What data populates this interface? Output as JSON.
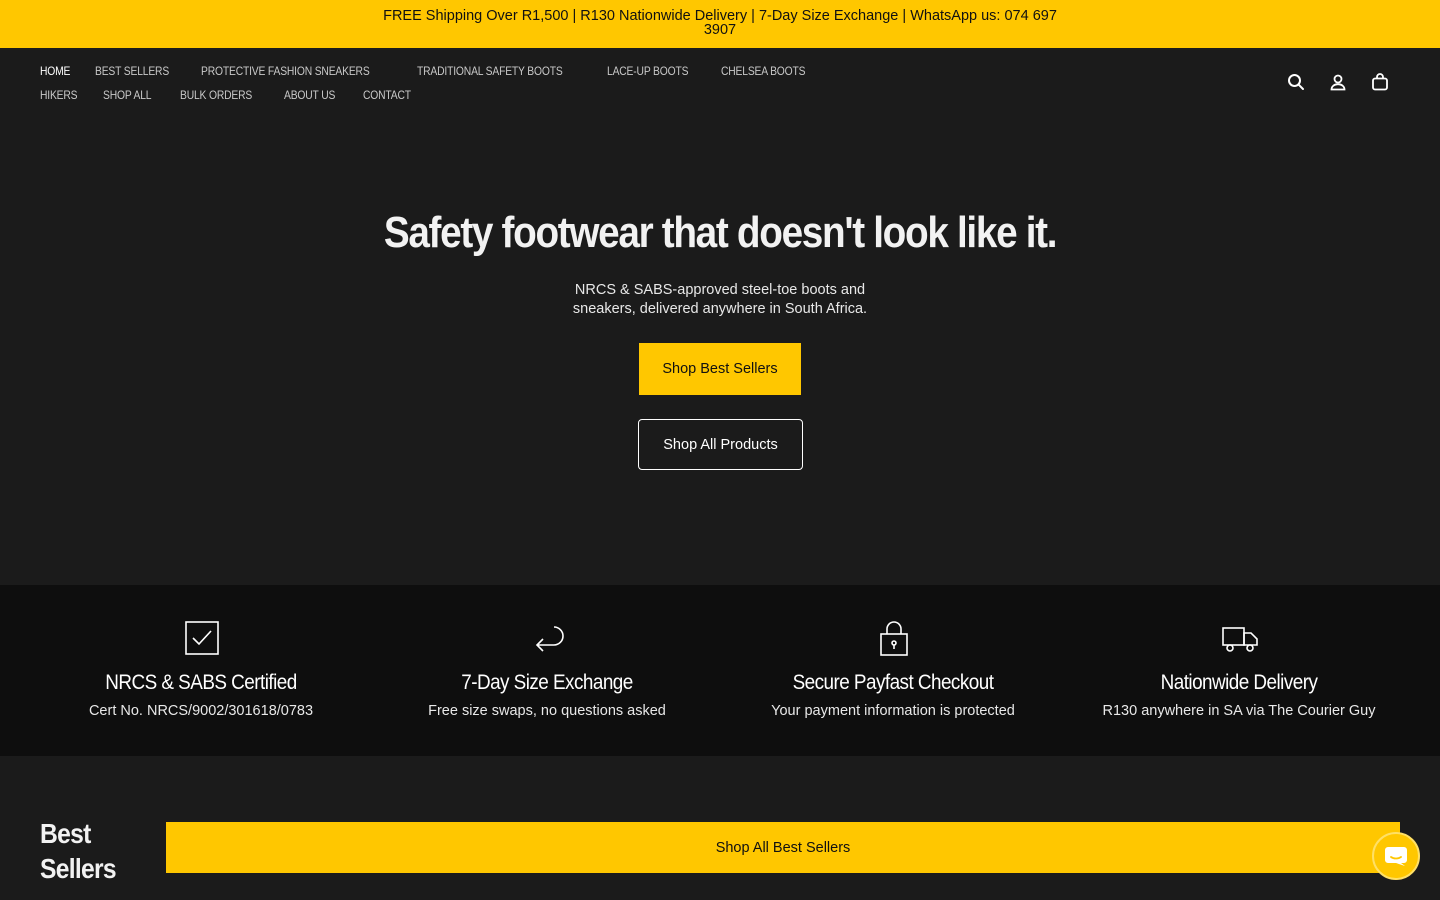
{
  "announcement": {
    "text": "FREE Shipping Over R1,500 | R130 Nationwide Delivery | 7-Day Size Exchange | WhatsApp us: 074 697 3907"
  },
  "nav": {
    "row1": [
      "HOME",
      "BEST SELLERS",
      "PROTECTIVE FASHION SNEAKERS",
      "TRADITIONAL SAFETY BOOTS",
      "LACE-UP BOOTS",
      "CHELSEA BOOTS"
    ],
    "row2": [
      "HIKERS",
      "SHOP ALL",
      "BULK ORDERS",
      "ABOUT US",
      "CONTACT"
    ],
    "active": "HOME",
    "icons": [
      "search-icon",
      "account-icon",
      "cart-icon"
    ]
  },
  "hero": {
    "title": "Safety footwear that doesn't look like it.",
    "subtitle": "NRCS & SABS-approved steel-toe boots and sneakers, delivered anywhere in South Africa.",
    "primary_button": "Shop Best Sellers",
    "secondary_button": "Shop All Products"
  },
  "features": [
    {
      "icon": "checkbox-icon",
      "title": "NRCS & SABS Certified",
      "subtitle": "Cert No. NRCS/9002/301618/0783"
    },
    {
      "icon": "return-arrow-icon",
      "title": "7-Day Size Exchange",
      "subtitle": "Free size swaps, no questions asked"
    },
    {
      "icon": "lock-icon",
      "title": "Secure Payfast Checkout",
      "subtitle": "Your payment information is protected"
    },
    {
      "icon": "truck-icon",
      "title": "Nationwide Delivery",
      "subtitle": "R130 anywhere in SA via The Courier Guy"
    }
  ],
  "best_sellers": {
    "title": "Best Sellers",
    "button": "Shop All Best Sellers"
  },
  "chat": {
    "icon": "chat-icon"
  },
  "colors": {
    "accent": "#ffc700",
    "background": "#1b1b1b",
    "feature_band": "#0e0e0e",
    "text": "#ffffff"
  }
}
